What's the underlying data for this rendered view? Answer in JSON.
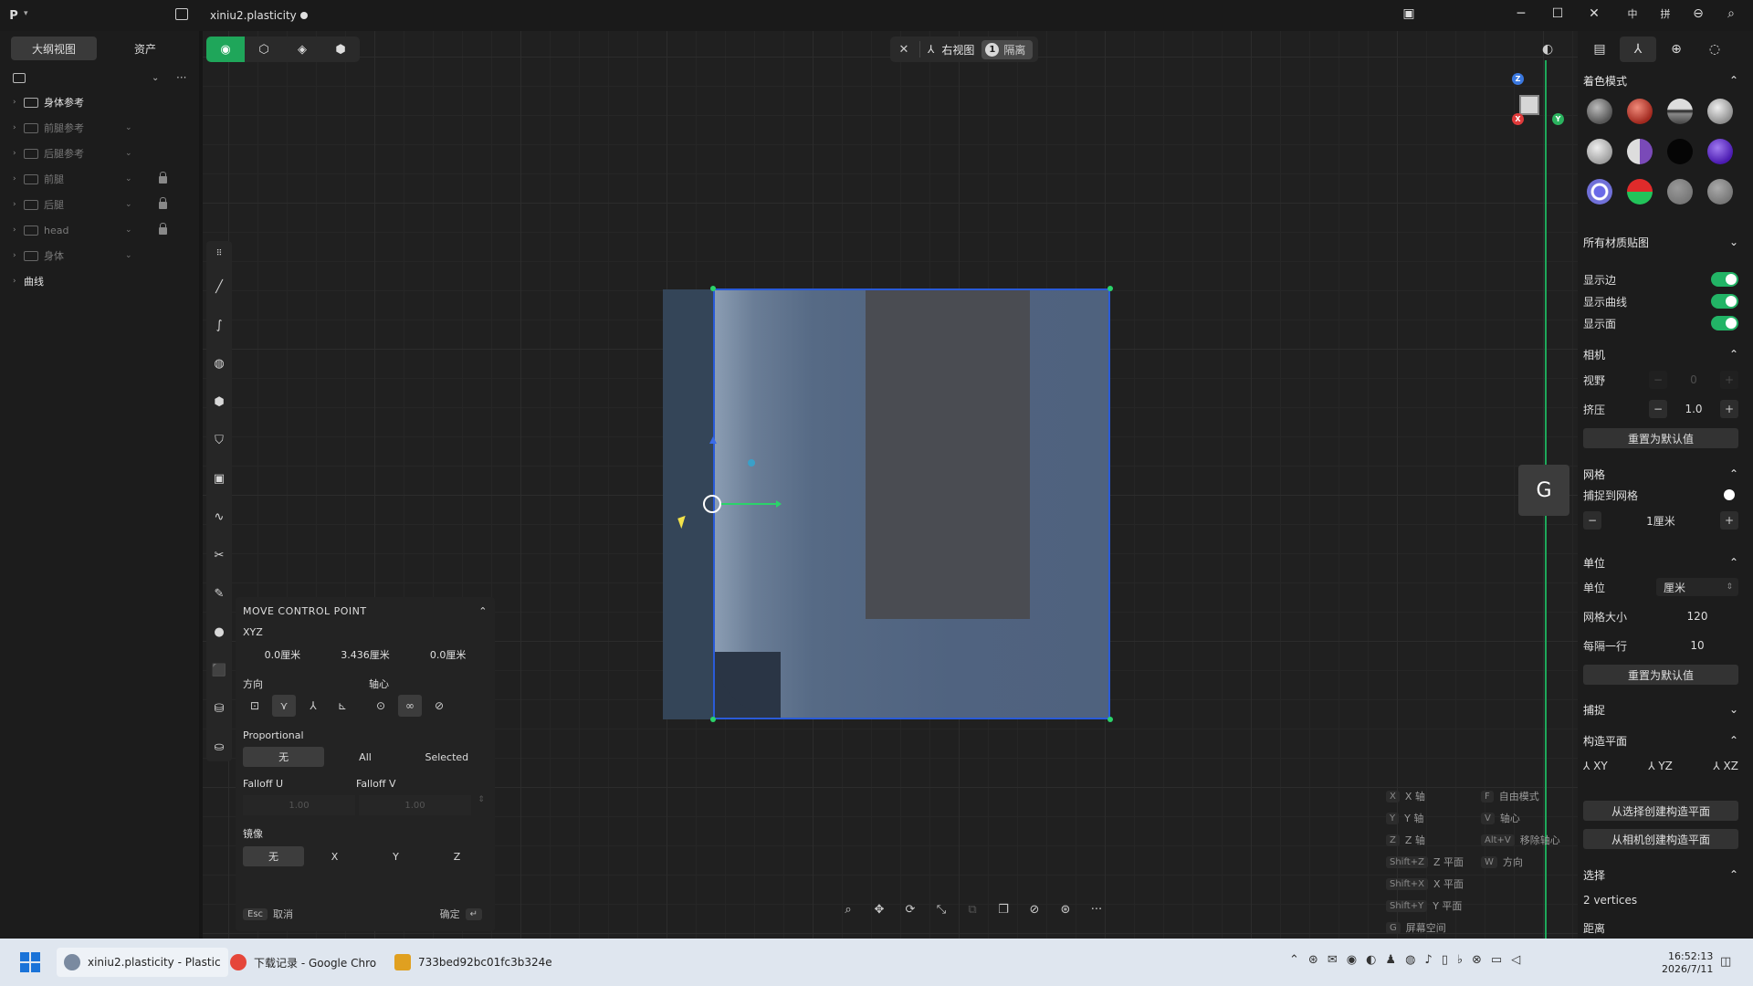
{
  "titlebar": {
    "logo": "P",
    "title": "xiniu2.plasticity",
    "icons": [
      "layout-icon",
      "minimize-icon",
      "maximize-icon",
      "close-icon",
      "ime-zh-icon",
      "ime-mode-icon",
      "zoom-out-icon",
      "search-icon"
    ]
  },
  "sidebar": {
    "tabs": [
      "大纲视图",
      "资产"
    ],
    "tree": [
      {
        "label": "身体参考",
        "dim": false,
        "lock": false,
        "eye": false
      },
      {
        "label": "前腿参考",
        "dim": true,
        "lock": false,
        "eye": true
      },
      {
        "label": "后腿参考",
        "dim": true,
        "lock": false,
        "eye": true
      },
      {
        "label": "前腿",
        "dim": true,
        "lock": true,
        "eye": true
      },
      {
        "label": "后腿",
        "dim": true,
        "lock": true,
        "eye": true
      },
      {
        "label": "head",
        "dim": true,
        "lock": true,
        "eye": true
      },
      {
        "label": "身体",
        "dim": true,
        "lock": false,
        "eye": true
      },
      {
        "label": "曲线",
        "dim": false,
        "lock": false,
        "eye": false
      }
    ]
  },
  "viewport": {
    "view_name": "右视图",
    "isolate_count": "1",
    "isolate_label": "隔离",
    "axis": {
      "z": "Z",
      "x": "X",
      "y": "Y"
    },
    "g_badge": "G"
  },
  "move_panel": {
    "title": "MOVE CONTROL POINT",
    "xyz_label": "XYZ",
    "xyz": [
      "0.0厘米",
      "3.436厘米",
      "0.0厘米"
    ],
    "direction_label": "方向",
    "pivot_label": "轴心",
    "proportional_label": "Proportional",
    "proportional_options": [
      "无",
      "All",
      "Selected"
    ],
    "falloff_u_label": "Falloff U",
    "falloff_v_label": "Falloff V",
    "falloff_u": "1.00",
    "falloff_v": "1.00",
    "mirror_label": "镜像",
    "mirror_options": [
      "无",
      "X",
      "Y",
      "Z"
    ],
    "esc_key": "Esc",
    "cancel": "取消",
    "confirm": "确定",
    "enter_key": "↵"
  },
  "hints": [
    {
      "key": "X",
      "label": "X 轴"
    },
    {
      "key": "Y",
      "label": "Y 轴"
    },
    {
      "key": "Z",
      "label": "Z 轴"
    },
    {
      "key": "Shift+Z",
      "label": "Z 平面"
    },
    {
      "key": "Shift+X",
      "label": "X 平面"
    },
    {
      "key": "Shift+Y",
      "label": "Y 平面"
    },
    {
      "key": "G",
      "label": "屏幕空间"
    }
  ],
  "hints2": [
    {
      "key": "F",
      "label": "自由模式"
    },
    {
      "key": "V",
      "label": "轴心"
    },
    {
      "key": "Alt+V",
      "label": "移除轴心"
    },
    {
      "key": "W",
      "label": "方向"
    }
  ],
  "right_panel": {
    "shading_title": "着色模式",
    "all_materials": "所有材质贴图",
    "show_edges": "显示边",
    "show_curves": "显示曲线",
    "show_faces": "显示面",
    "camera_title": "相机",
    "fov_label": "视野",
    "fov_value": "0",
    "squeeze_label": "挤压",
    "squeeze_value": "1.0",
    "reset_default": "重置为默认值",
    "grid_title": "网格",
    "snap_to_grid": "捕捉到网格",
    "grid_step": "1厘米",
    "units_title": "单位",
    "units_label": "单位",
    "units_value": "厘米",
    "grid_size_label": "网格大小",
    "grid_size_value": "120",
    "every_line_label": "每隔一行",
    "every_line_value": "10",
    "reset_default2": "重置为默认值",
    "snap_title": "捕捉",
    "cplane_title": "构造平面",
    "planes": [
      "XY",
      "YZ",
      "XZ"
    ],
    "cplane_from_selection": "从选择创建构造平面",
    "cplane_from_camera": "从相机创建构造平面",
    "selection_title": "选择",
    "selection_value": "2 vertices",
    "distance_label": "距离"
  },
  "taskbar": {
    "apps": [
      {
        "label": "xiniu2.plasticity - Plastic",
        "color": "#7a8aa0"
      },
      {
        "label": "下载记录 - Google Chro",
        "color": "#e5463a"
      },
      {
        "label": "733bed92bc01fc3b324e",
        "color": "#e0a020"
      }
    ],
    "time": "16:52:13",
    "date": "2026/7/11"
  },
  "colors": {
    "accent": "#1fa65a",
    "selection_edge": "#2a5bd8",
    "object": "#506380"
  }
}
